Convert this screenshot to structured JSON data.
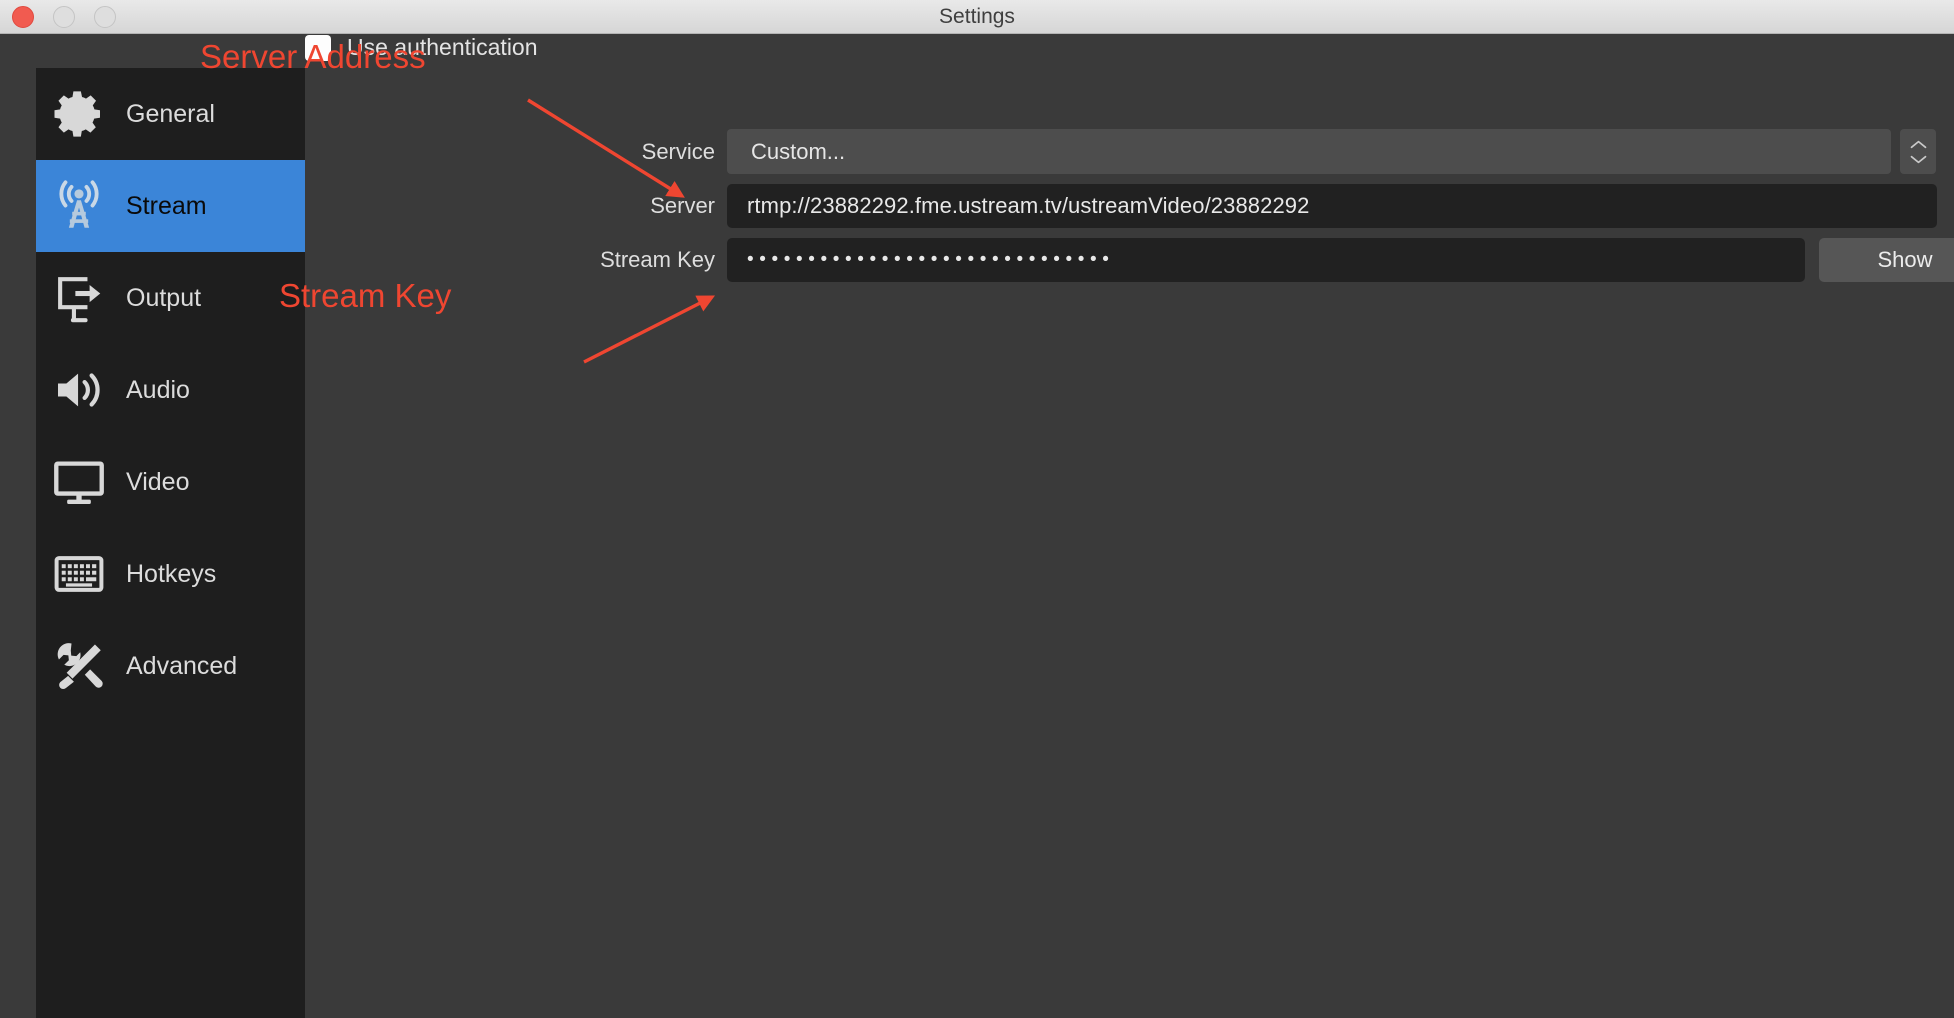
{
  "window": {
    "title": "Settings",
    "traffic_lights": [
      "close-button",
      "minimize-button",
      "maximize-button"
    ]
  },
  "sidebar": {
    "items": [
      {
        "label": "General",
        "icon": "gear-icon",
        "active": false
      },
      {
        "label": "Stream",
        "icon": "broadcast-icon",
        "active": true
      },
      {
        "label": "Output",
        "icon": "output-icon",
        "active": false
      },
      {
        "label": "Audio",
        "icon": "speaker-icon",
        "active": false
      },
      {
        "label": "Video",
        "icon": "monitor-icon",
        "active": false
      },
      {
        "label": "Hotkeys",
        "icon": "keyboard-icon",
        "active": false
      },
      {
        "label": "Advanced",
        "icon": "tools-icon",
        "active": false
      }
    ]
  },
  "stream_form": {
    "service_label": "Service",
    "service_value": "Custom...",
    "server_label": "Server",
    "server_value": "rtmp://23882292.fme.ustream.tv/ustreamVideo/23882292",
    "stream_key_label": "Stream Key",
    "stream_key_masked": "••••••••••••••••••••••••••••••",
    "show_button_label": "Show",
    "use_authentication_label": "Use authentication",
    "use_authentication_checked": false
  },
  "annotations": [
    {
      "text": "Server Address",
      "color": "#ef4631"
    },
    {
      "text": "Stream Key",
      "color": "#ef4631"
    }
  ],
  "colors": {
    "accent_blue": "#3b85d8",
    "annotation_red": "#ef4631",
    "window_bg": "#3a3a3a",
    "sidebar_bg": "#1e1e1e",
    "field_bg": "#212121"
  }
}
